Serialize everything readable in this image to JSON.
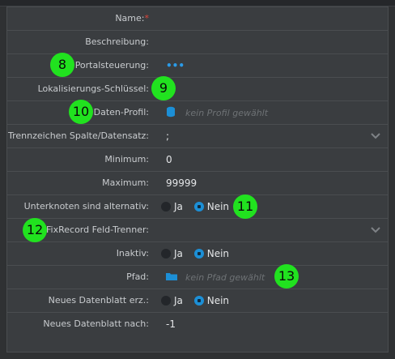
{
  "fields": {
    "name": {
      "label": "Name:",
      "required_mark": "*"
    },
    "beschreibung": {
      "label": "Beschreibung:"
    },
    "portalsteuerung": {
      "label": "Portalsteuerung:",
      "value": "•••"
    },
    "lokalisierung": {
      "label": "Lokalisierungs-Schlüssel:"
    },
    "datenprofil": {
      "label": "Daten-Profil:",
      "placeholder": "kein Profil gewählt"
    },
    "trennzeichen": {
      "label": "Trennzeichen Spalte/Datensatz:",
      "value": ";"
    },
    "minimum": {
      "label": "Minimum:",
      "value": "0"
    },
    "maximum": {
      "label": "Maximum:",
      "value": "99999"
    },
    "unterknoten": {
      "label": "Unterknoten sind alternativ:",
      "option_yes": "Ja",
      "option_no": "Nein",
      "selected": "Nein"
    },
    "fixrecord": {
      "label": "FixRecord Feld-Trenner:"
    },
    "inaktiv": {
      "label": "Inaktiv:",
      "option_yes": "Ja",
      "option_no": "Nein",
      "selected": "Nein"
    },
    "pfad": {
      "label": "Pfad:",
      "placeholder": "kein Pfad gewählt"
    },
    "neues_erz": {
      "label": "Neues Datenblatt erz.:",
      "option_yes": "Ja",
      "option_no": "Nein",
      "selected": "Nein"
    },
    "neues_nach": {
      "label": "Neues Datenblatt nach:",
      "value": "-1"
    }
  },
  "badges": {
    "b8": "8",
    "b9": "9",
    "b10": "10",
    "b11": "11",
    "b12": "12",
    "b13": "13"
  },
  "colors": {
    "accent": "#1c8fd6",
    "badge": "#21e21f",
    "required": "#e0453a"
  },
  "icons": {
    "datenprofil": "database-icon",
    "pfad": "folder-icon",
    "dropdown": "chevron-down-icon"
  }
}
